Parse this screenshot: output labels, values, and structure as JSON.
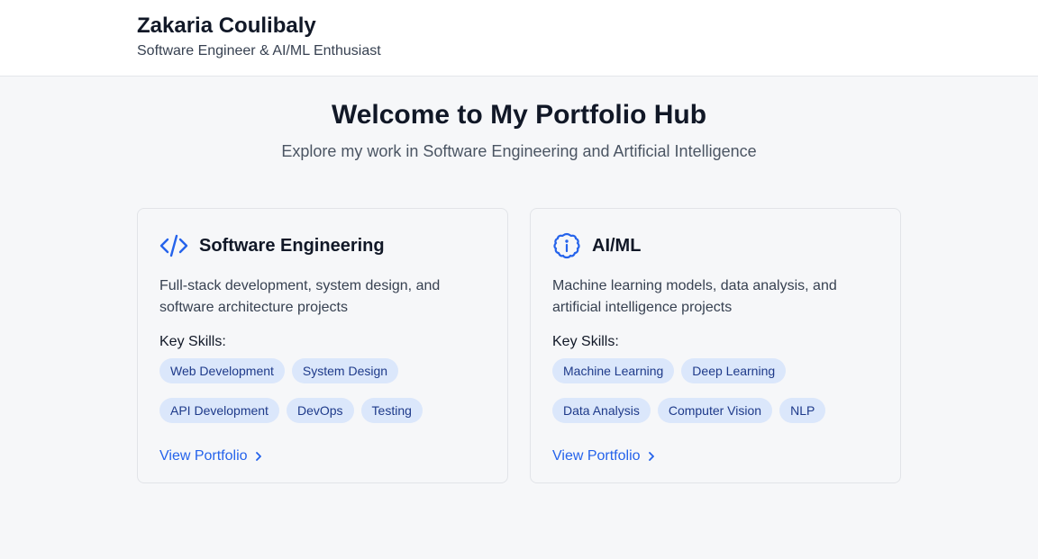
{
  "header": {
    "name": "Zakaria Coulibaly",
    "tagline": "Software Engineer & AI/ML Enthusiast"
  },
  "hero": {
    "title": "Welcome to My Portfolio Hub",
    "subtitle": "Explore my work in Software Engineering and Artificial Intelligence"
  },
  "cards": [
    {
      "icon": "code-icon",
      "title": "Software Engineering",
      "description": "Full-stack development, system design, and software architecture projects",
      "skills_label": "Key Skills:",
      "skills": [
        "Web Development",
        "System Design",
        "API Development",
        "DevOps",
        "Testing"
      ],
      "link_label": "View Portfolio"
    },
    {
      "icon": "brain-icon",
      "title": "AI/ML",
      "description": "Machine learning models, data analysis, and artificial intelligence projects",
      "skills_label": "Key Skills:",
      "skills": [
        "Machine Learning",
        "Deep Learning",
        "Data Analysis",
        "Computer Vision",
        "NLP"
      ],
      "link_label": "View Portfolio"
    }
  ],
  "colors": {
    "accent": "#2563eb",
    "chip_bg": "#dbe7fb",
    "chip_text": "#1e3a8a",
    "page_bg": "#f6f7f9"
  }
}
